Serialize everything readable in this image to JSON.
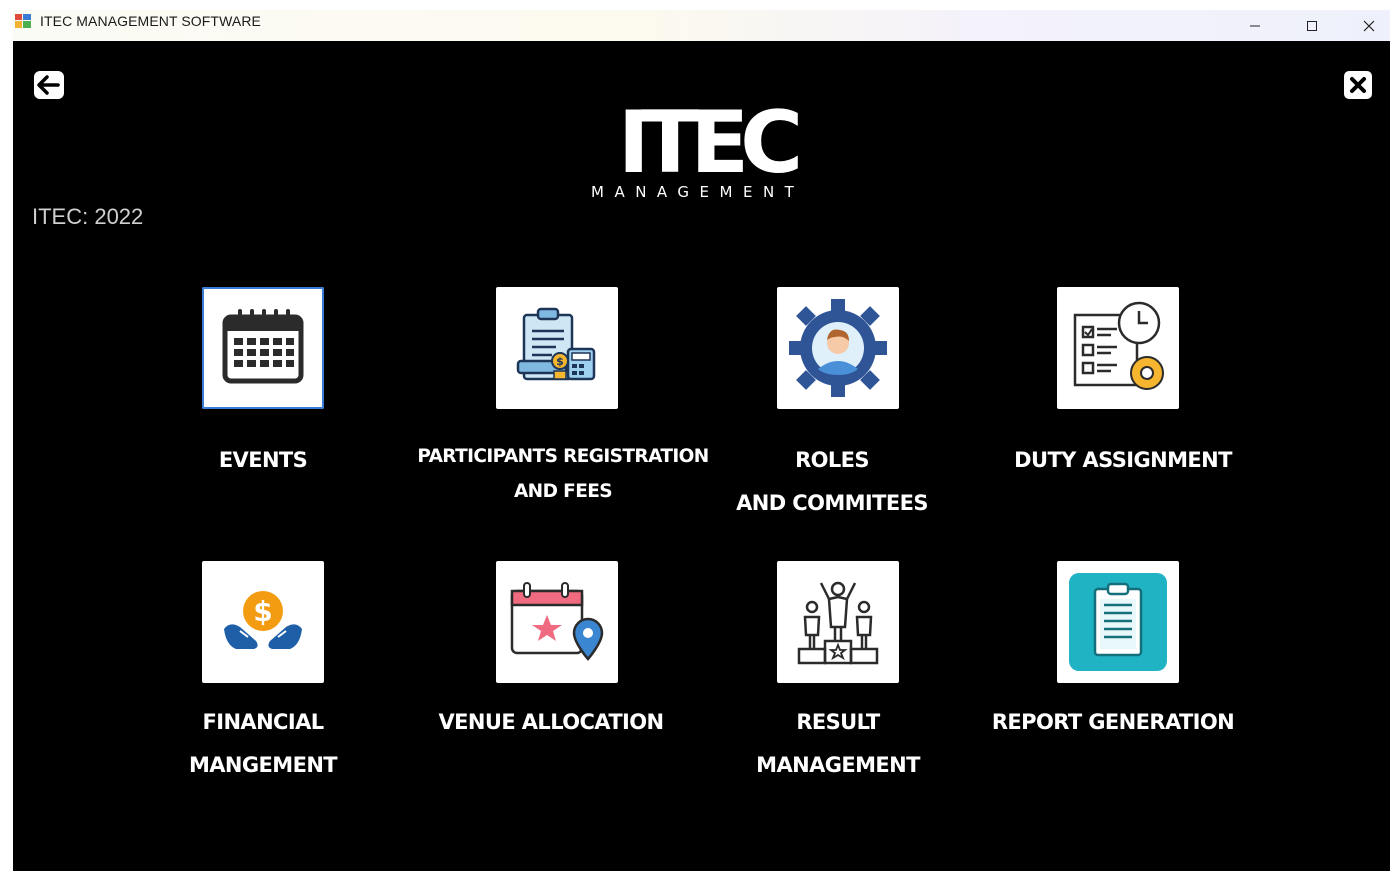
{
  "window": {
    "title": "ITEC MANAGEMENT SOFTWARE",
    "minimize": "—",
    "maximize": "☐",
    "close": "✕"
  },
  "header": {
    "logo_text": "ITEC",
    "logo_subtext": "MANAGEMENT",
    "year_label": "ITEC: 2022",
    "back_icon": "arrow-left-icon",
    "exit_icon": "close-x-icon"
  },
  "modules": [
    {
      "line1": "EVENTS",
      "line2": "",
      "icon": "calendar-icon"
    },
    {
      "line1": "PARTICIPANTS REGISTRATION",
      "line2": "AND FEES",
      "icon": "registration-clipboard-icon"
    },
    {
      "line1": "ROLES",
      "line2": "AND COMMITEES",
      "icon": "gear-person-icon"
    },
    {
      "line1": "DUTY ASSIGNMENT",
      "line2": "",
      "icon": "checklist-clock-icon"
    },
    {
      "line1": "FINANCIAL",
      "line2": "MANGEMENT",
      "icon": "hands-dollar-icon"
    },
    {
      "line1": "VENUE ALLOCATION",
      "line2": "",
      "icon": "calendar-location-icon"
    },
    {
      "line1": "RESULT",
      "line2": "MANAGEMENT",
      "icon": "podium-icon"
    },
    {
      "line1": "REPORT GENERATION",
      "line2": "",
      "icon": "report-clipboard-icon"
    }
  ],
  "colors": {
    "background": "#000000",
    "tile": "#ffffff",
    "gear_blue": "#2f5597",
    "report_teal": "#1fb3c3",
    "dollar_orange": "#f39c12"
  }
}
